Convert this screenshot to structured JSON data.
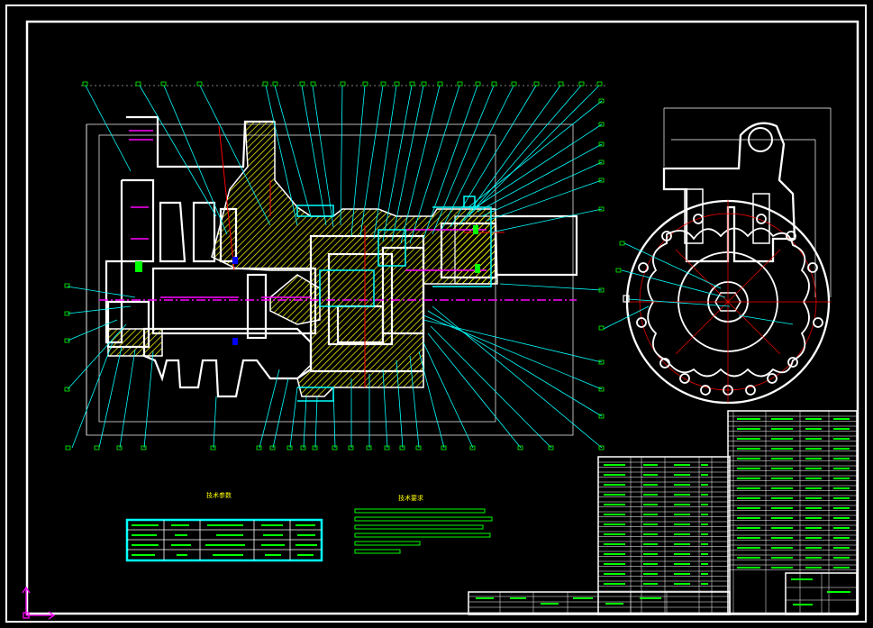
{
  "drawing": {
    "colors": {
      "background": "#000000",
      "frame": "#ffffff",
      "leader": "#00ffff",
      "hatch": "#ffff00",
      "centerline": "#ff0000",
      "hidden": "#ff00ff",
      "table": "#00ff00",
      "axis": "#ff00ff"
    },
    "technical_requirements_title": "技术要求",
    "parts_table_title": "技术参数",
    "section_view": "front-section",
    "end_view": "side-view",
    "title_block": "title-block"
  }
}
